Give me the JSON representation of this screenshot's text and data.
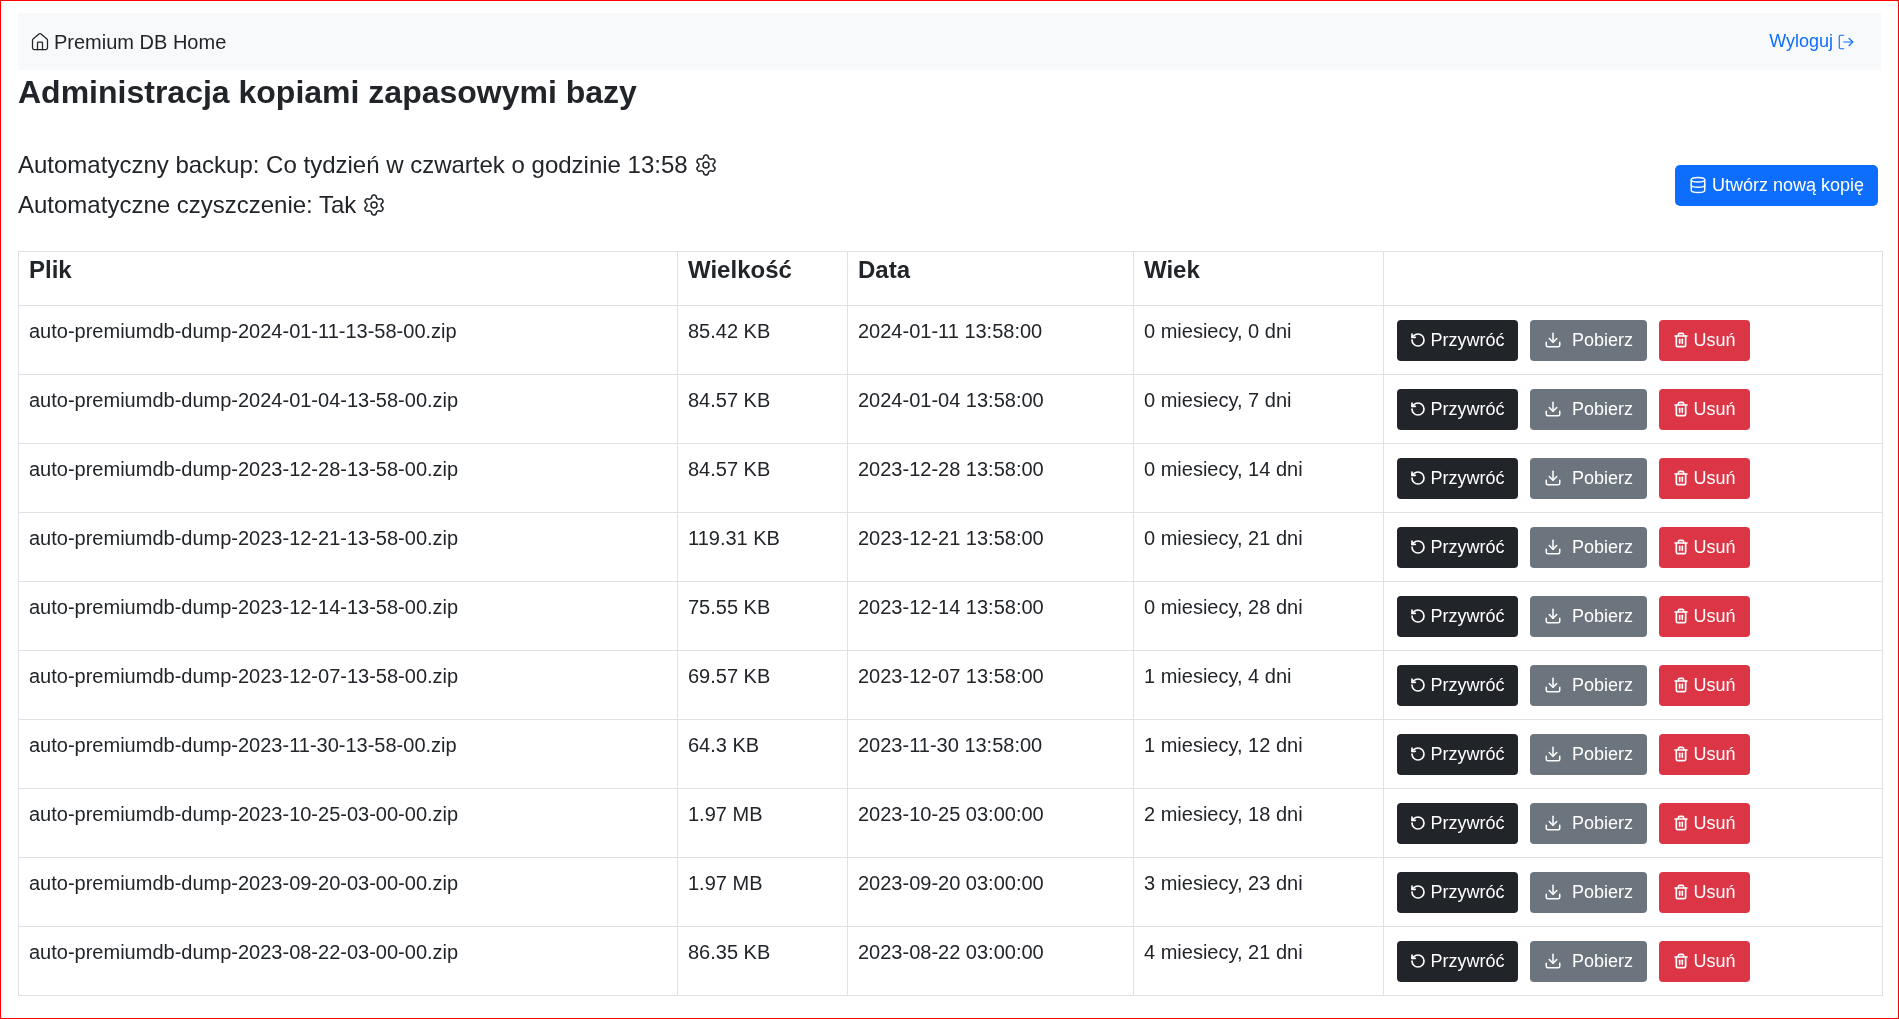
{
  "navbar": {
    "brand": "Premium DB Home",
    "logout": "Wyloguj"
  },
  "title": "Administracja kopiami zapasowymi bazy",
  "settings": [
    {
      "text": "Automatyczny backup: Co tydzień w czwartek o godzinie 13:58"
    },
    {
      "text": "Automatyczne czyszczenie: Tak"
    }
  ],
  "create_button": "Utwórz nową kopię",
  "table": {
    "columns": [
      "Plik",
      "Wielkość",
      "Data",
      "Wiek"
    ],
    "rows": [
      {
        "file": "auto-premiumdb-dump-2024-01-11-13-58-00.zip",
        "size": "85.42 KB",
        "date": "2024-01-11 13:58:00",
        "age": "0 miesiecy, 0 dni",
        "restore": "Przywróć",
        "download": "Pobierz",
        "delete": "Usuń"
      },
      {
        "file": "auto-premiumdb-dump-2024-01-04-13-58-00.zip",
        "size": "84.57 KB",
        "date": "2024-01-04 13:58:00",
        "age": "0 miesiecy, 7 dni",
        "restore": "Przywróć",
        "download": "Pobierz",
        "delete": "Usuń"
      },
      {
        "file": "auto-premiumdb-dump-2023-12-28-13-58-00.zip",
        "size": "84.57 KB",
        "date": "2023-12-28 13:58:00",
        "age": "0 miesiecy, 14 dni",
        "restore": "Przywróć",
        "download": "Pobierz",
        "delete": "Usuń"
      },
      {
        "file": "auto-premiumdb-dump-2023-12-21-13-58-00.zip",
        "size": "119.31 KB",
        "date": "2023-12-21 13:58:00",
        "age": "0 miesiecy, 21 dni",
        "restore": "Przywróć",
        "download": "Pobierz",
        "delete": "Usuń"
      },
      {
        "file": "auto-premiumdb-dump-2023-12-14-13-58-00.zip",
        "size": "75.55 KB",
        "date": "2023-12-14 13:58:00",
        "age": "0 miesiecy, 28 dni",
        "restore": "Przywróć",
        "download": "Pobierz",
        "delete": "Usuń"
      },
      {
        "file": "auto-premiumdb-dump-2023-12-07-13-58-00.zip",
        "size": "69.57 KB",
        "date": "2023-12-07 13:58:00",
        "age": "1 miesiecy, 4 dni",
        "restore": "Przywróć",
        "download": "Pobierz",
        "delete": "Usuń"
      },
      {
        "file": "auto-premiumdb-dump-2023-11-30-13-58-00.zip",
        "size": "64.3 KB",
        "date": "2023-11-30 13:58:00",
        "age": "1 miesiecy, 12 dni",
        "restore": "Przywróć",
        "download": "Pobierz",
        "delete": "Usuń"
      },
      {
        "file": "auto-premiumdb-dump-2023-10-25-03-00-00.zip",
        "size": "1.97 MB",
        "date": "2023-10-25 03:00:00",
        "age": "2 miesiecy, 18 dni",
        "restore": "Przywróć",
        "download": "Pobierz",
        "delete": "Usuń"
      },
      {
        "file": "auto-premiumdb-dump-2023-09-20-03-00-00.zip",
        "size": "1.97 MB",
        "date": "2023-09-20 03:00:00",
        "age": "3 miesiecy, 23 dni",
        "restore": "Przywróć",
        "download": "Pobierz",
        "delete": "Usuń"
      },
      {
        "file": "auto-premiumdb-dump-2023-08-22-03-00-00.zip",
        "size": "86.35 KB",
        "date": "2023-08-22 03:00:00",
        "age": "4 miesiecy, 21 dni",
        "restore": "Przywróć",
        "download": "Pobierz",
        "delete": "Usuń"
      }
    ]
  }
}
